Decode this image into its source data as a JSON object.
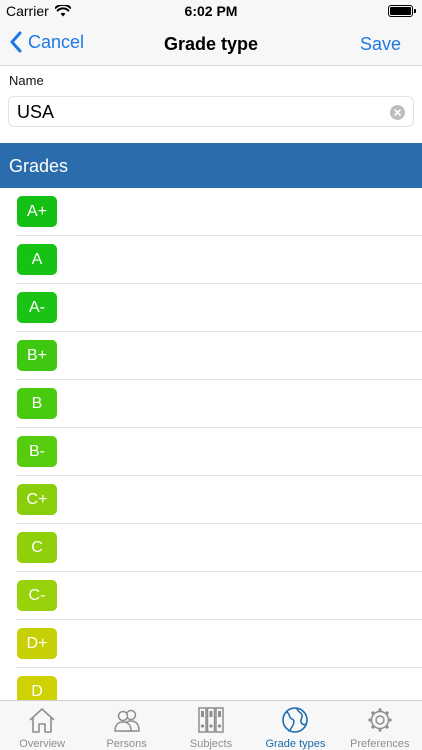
{
  "status_bar": {
    "carrier": "Carrier",
    "time": "6:02 PM"
  },
  "nav": {
    "back_label": "Cancel",
    "title": "Grade type",
    "save_label": "Save"
  },
  "form": {
    "name_label": "Name",
    "name_value": "USA"
  },
  "section": {
    "title": "Grades"
  },
  "grades": [
    {
      "label": "A+",
      "color": "#13c013"
    },
    {
      "label": "A",
      "color": "#16c214"
    },
    {
      "label": "A-",
      "color": "#1bc414"
    },
    {
      "label": "B+",
      "color": "#3ec80f"
    },
    {
      "label": "B",
      "color": "#48ca0e"
    },
    {
      "label": "B-",
      "color": "#55cc0d"
    },
    {
      "label": "C+",
      "color": "#88ce0a"
    },
    {
      "label": "C",
      "color": "#8fd00a"
    },
    {
      "label": "C-",
      "color": "#97d20a"
    },
    {
      "label": "D+",
      "color": "#c7d004"
    },
    {
      "label": "D",
      "color": "#ced204"
    }
  ],
  "tabs": [
    {
      "label": "Overview",
      "icon": "house-icon",
      "active": false
    },
    {
      "label": "Persons",
      "icon": "persons-icon",
      "active": false
    },
    {
      "label": "Subjects",
      "icon": "binders-icon",
      "active": false
    },
    {
      "label": "Grade types",
      "icon": "globe-icon",
      "active": true
    },
    {
      "label": "Preferences",
      "icon": "gear-icon",
      "active": false
    }
  ],
  "colors": {
    "accent": "#1e78e6",
    "section_header": "#2b6cad",
    "active_tab": "#1c6bb0",
    "inactive_tab": "#8e8e8e"
  }
}
